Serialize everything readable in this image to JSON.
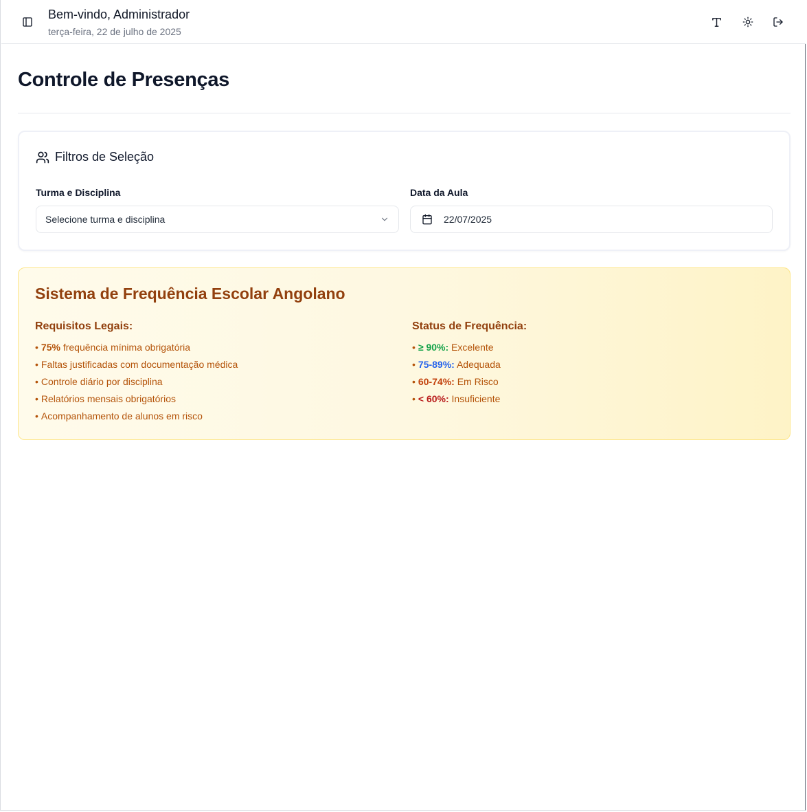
{
  "header": {
    "welcome": "Bem-vindo, Administrador",
    "date": "terça-feira, 22 de julho de 2025"
  },
  "page": {
    "title": "Controle de Presenças"
  },
  "filters": {
    "title": "Filtros de Seleção",
    "turma_label": "Turma e Disciplina",
    "turma_value": "Selecione turma e disciplina",
    "data_label": "Data da Aula",
    "data_value": "22/07/2025"
  },
  "info": {
    "title": "Sistema de Frequência Escolar Angolano",
    "requisitos_title": "Requisitos Legais:",
    "requisitos": [
      {
        "bold": "75%",
        "text": " frequência mínima obrigatória"
      },
      {
        "bold": "",
        "text": "Faltas justificadas com documentação médica"
      },
      {
        "bold": "",
        "text": "Controle diário por disciplina"
      },
      {
        "bold": "",
        "text": "Relatórios mensais obrigatórios"
      },
      {
        "bold": "",
        "text": "Acompanhamento de alunos em risco"
      }
    ],
    "status_title": "Status de Frequência:",
    "status": [
      {
        "range": "≥ 90%:",
        "label": " Excelente",
        "color": "#16a34a"
      },
      {
        "range": "75-89%:",
        "label": " Adequada",
        "color": "#2563eb"
      },
      {
        "range": "60-74%:",
        "label": " Em Risco",
        "color": "#c2410c"
      },
      {
        "range": "< 60%:",
        "label": " Insuficiente",
        "color": "#b91c1c"
      }
    ]
  },
  "colors": {
    "info_text": "#b45309",
    "info_heading": "#92400e",
    "info_border": "#fde68a"
  },
  "icons": {
    "sidebar_toggle": "panel-left-icon",
    "font": "type-icon",
    "theme": "sun-icon",
    "logout": "log-out-icon",
    "filters": "users-icon",
    "select": "chevron-down-icon",
    "date": "calendar-icon"
  }
}
